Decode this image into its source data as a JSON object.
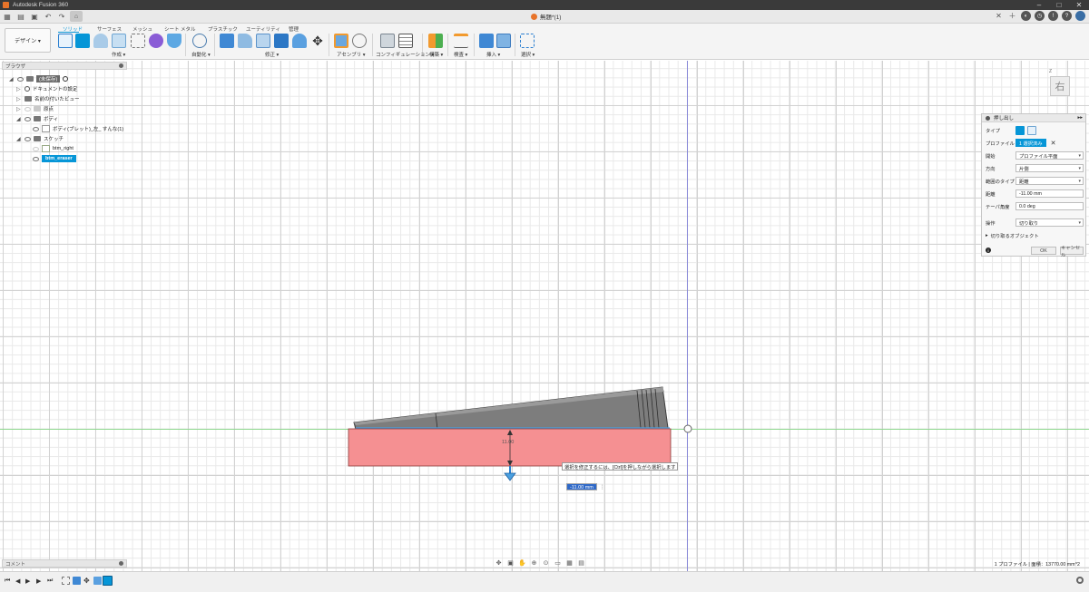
{
  "window": {
    "title": "Autodesk Fusion 360",
    "minimize": "–",
    "maximize": "□",
    "close": "✕"
  },
  "document_tab": {
    "name": "無題*(1)",
    "close": "✕"
  },
  "ribbon": {
    "workspace": "デザイン ▾",
    "tabs": [
      "ソリッド",
      "サーフェス",
      "メッシュ",
      "シート メタル",
      "プラスチック",
      "ユーティリティ",
      "管理"
    ],
    "active_tab": "ソリッド",
    "groups": [
      "作成 ▾",
      "自動化 ▾",
      "修正 ▾",
      "アセンブリ ▾",
      "コンフィギュレーション ▾",
      "構築 ▾",
      "検査 ▾",
      "挿入 ▾",
      "選択 ▾"
    ],
    "colors": {
      "accent": "#0696d7",
      "orange": "#f29a2e",
      "purple": "#8a5cd6",
      "green": "#4caf50"
    }
  },
  "browser": {
    "title": "ブラウザ",
    "root": "(未保存)",
    "items": [
      "ドキュメントの設定",
      "名前の付いたビュー",
      "原点",
      "ボディ",
      "ボディ(ブレット)_左_ すんな(1)",
      "スケッチ",
      "btm_right",
      "btm_eraser"
    ]
  },
  "viewport": {
    "dimension_label": "11.00",
    "hint_text": "選択を修正するには、[Ctrl]を押しながら選択します",
    "input_value": "-11.00 mm",
    "viewcube_label": "右",
    "viewcube_axis": "Z"
  },
  "extrude_panel": {
    "title": "押し出し",
    "fields": [
      {
        "label": "タイプ",
        "value": ""
      },
      {
        "label": "プロファイル",
        "value": "1 選択済み"
      },
      {
        "label": "開始",
        "value": "プロファイル平面"
      },
      {
        "label": "方向",
        "value": "片側"
      },
      {
        "label": "範囲のタイプ",
        "value": "距離"
      },
      {
        "label": "距離",
        "value": "-11.00 mm"
      },
      {
        "label": "テーパ角度",
        "value": "0.0 deg"
      },
      {
        "label": "操作",
        "value": "切り取り"
      }
    ],
    "section": "切り取るオブジェクト",
    "ok": "OK",
    "cancel": "キャンセル"
  },
  "comments": {
    "title": "コメント"
  },
  "status": {
    "profile_area": "1 プロファイル | 面積：13770.00 mm^2"
  }
}
